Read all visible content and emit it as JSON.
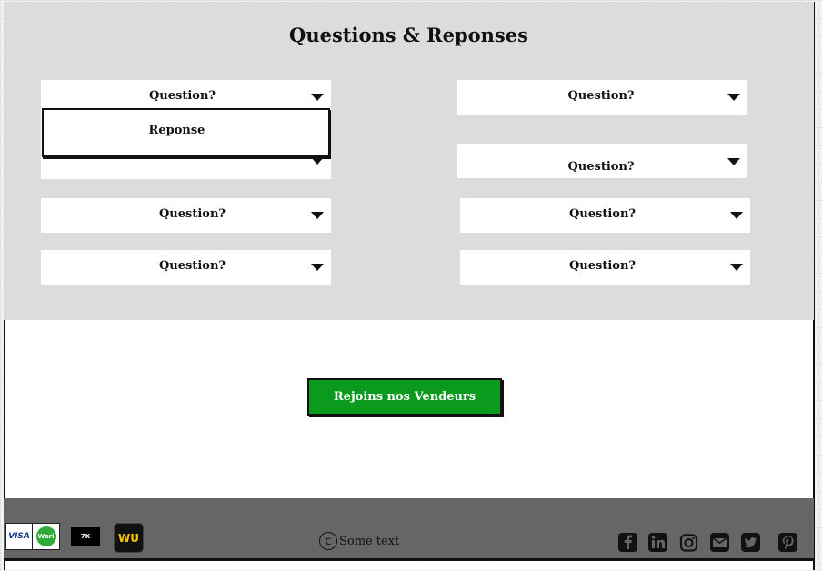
{
  "faq": {
    "title": "Questions & Reponses",
    "questions": [
      {
        "label": "Question?"
      },
      {
        "label": "Question?"
      },
      {
        "label": "Question?"
      },
      {
        "label": "Question?"
      },
      {
        "label": "Question?"
      },
      {
        "label": "Question?"
      },
      {
        "label": "Question?"
      },
      {
        "label": "Question?"
      }
    ],
    "answer": "Reponse"
  },
  "cta": {
    "label": "Rejoins nos Vendeurs",
    "color": "#0a9a1e"
  },
  "footer": {
    "copyright_text": "Some text",
    "payment_methods": [
      {
        "name": "visa",
        "label": "VISA"
      },
      {
        "name": "wari",
        "label": "Wari"
      },
      {
        "name": "money-transfer",
        "label": "7K"
      },
      {
        "name": "western-union",
        "label": "WU"
      }
    ],
    "social_icons": [
      "facebook-icon",
      "linkedin-icon",
      "instagram-icon",
      "mail-icon",
      "twitter-icon",
      "pinterest-icon"
    ]
  }
}
